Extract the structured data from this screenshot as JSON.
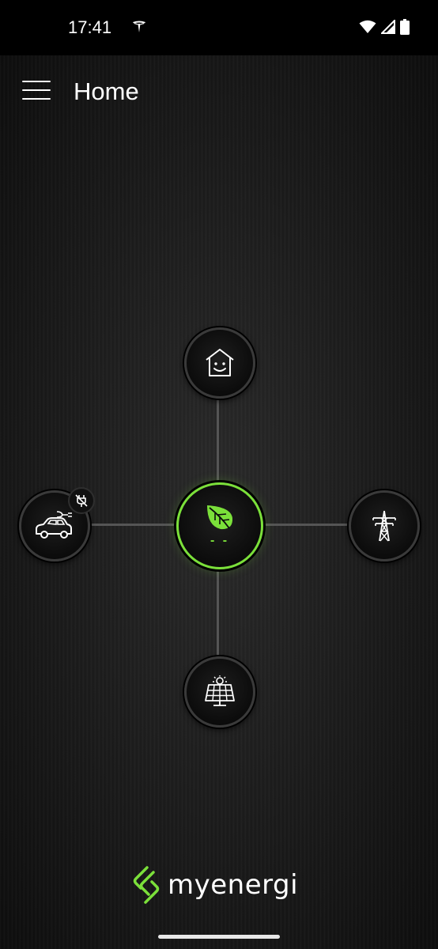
{
  "status_bar": {
    "time": "17:41",
    "icons": [
      "tesla-icon",
      "wifi-icon",
      "signal-icon",
      "battery-icon"
    ]
  },
  "app_bar": {
    "title": "Home",
    "menu_icon": "hamburger-menu-icon"
  },
  "flow": {
    "nodes": [
      {
        "name": "home",
        "icon": "house-smiley-icon"
      },
      {
        "name": "eco",
        "icon": "leaf-icon",
        "value": "- -",
        "accent": "#7be03a"
      },
      {
        "name": "ev",
        "icon": "car-plug-icon",
        "badge_icon": "unplugged-icon"
      },
      {
        "name": "grid",
        "icon": "pylon-icon"
      },
      {
        "name": "solar",
        "icon": "solar-panel-icon"
      }
    ]
  },
  "brand": {
    "logo_text": "myenergi",
    "accent": "#7be03a"
  }
}
